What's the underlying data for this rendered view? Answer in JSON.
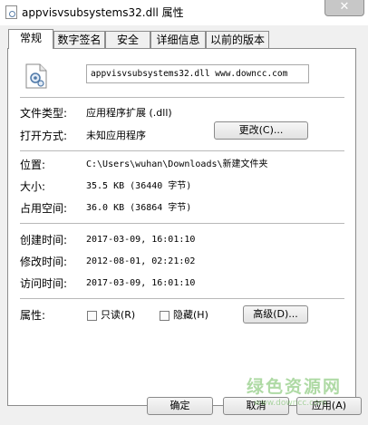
{
  "window": {
    "title": "appvisvsubsystems32.dll 属性",
    "close_glyph": "✕"
  },
  "tabs": [
    {
      "label": "常规",
      "active": true
    },
    {
      "label": "数字签名",
      "active": false
    },
    {
      "label": "安全",
      "active": false
    },
    {
      "label": "详细信息",
      "active": false
    },
    {
      "label": "以前的版本",
      "active": false
    }
  ],
  "general": {
    "icon": "dll-gear-file-icon",
    "filename": "appvisvsubsystems32.dll www.downcc.com",
    "file_type_label": "文件类型:",
    "file_type_value": "应用程序扩展 (.dll)",
    "opens_with_label": "打开方式:",
    "opens_with_value": "未知应用程序",
    "change_button": "更改(C)...",
    "location_label": "位置:",
    "location_value": "C:\\Users\\wuhan\\Downloads\\新建文件夹",
    "size_label": "大小:",
    "size_value": "35.5 KB (36440 字节)",
    "size_on_disk_label": "占用空间:",
    "size_on_disk_value": "36.0 KB (36864 字节)",
    "created_label": "创建时间:",
    "created_value": "2017-03-09, 16:01:10",
    "modified_label": "修改时间:",
    "modified_value": "2012-08-01, 02:21:02",
    "accessed_label": "访问时间:",
    "accessed_value": "2017-03-09, 16:01:10",
    "attributes_label": "属性:",
    "readonly_label": "只读(R)",
    "readonly_checked": false,
    "hidden_label": "隐藏(H)",
    "hidden_checked": false,
    "advanced_button": "高级(D)..."
  },
  "footer": {
    "ok_button": "确定",
    "cancel_button": "取消",
    "apply_button": "应用(A)"
  },
  "watermark": {
    "text": "绿色资源网",
    "url": "www.downcc.com"
  },
  "colors": {
    "window_bg": "#f0f0f0",
    "panel_bg": "#ffffff",
    "border": "#8c8c8c",
    "watermark_green": "#4fae3a"
  }
}
